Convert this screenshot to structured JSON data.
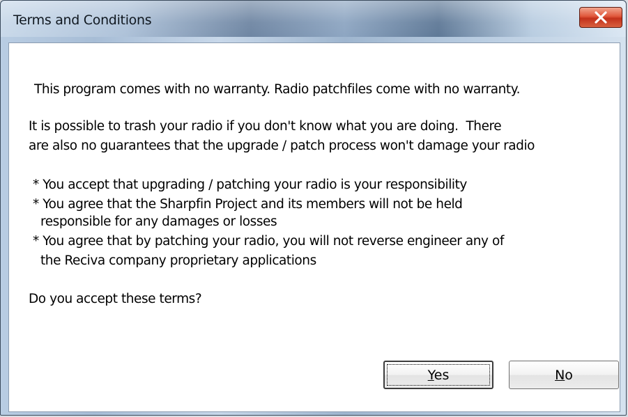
{
  "window": {
    "title": "Terms and Conditions",
    "close_icon": "close-x-icon"
  },
  "body": {
    "line1": "This program comes with no warranty. Radio patchfiles come with no warranty.",
    "para2_line1": "It is possible to trash your radio if you don't know what you are doing.  There",
    "para2_line2": "are also no guarantees that the upgrade / patch process won't damage your radio",
    "bullet1": "* You accept that upgrading / patching your radio is your responsibility",
    "bullet2_line1": "* You agree that the Sharpfin Project and its members will not be held",
    "bullet2_line2": "responsible for any damages or losses",
    "bullet3_line1": "* You agree that by patching your radio, you will not reverse engineer any of",
    "bullet3_line2": "the Reciva company proprietary applications",
    "question": "Do you accept these terms?"
  },
  "buttons": {
    "yes": {
      "mnemonic": "Y",
      "rest": "es"
    },
    "no": {
      "mnemonic": "N",
      "rest": "o"
    }
  },
  "colors": {
    "close_button": "#d9482c",
    "titlebar": "#8ea6c2",
    "content_background": "#ffffff"
  }
}
